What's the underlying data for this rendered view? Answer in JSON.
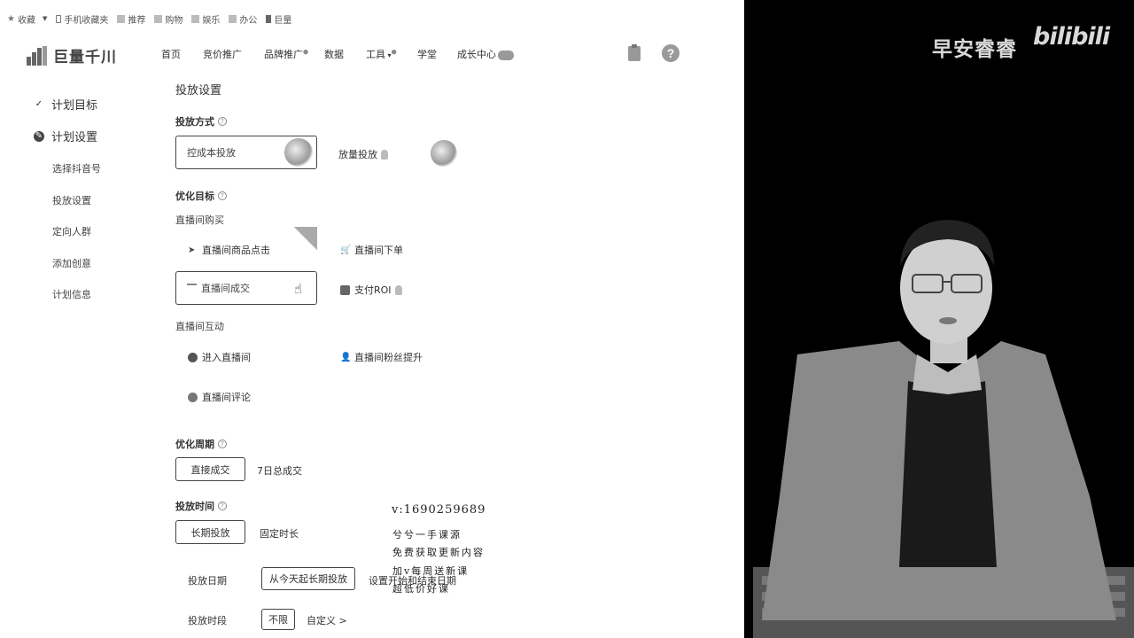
{
  "bookmarks": [
    "收藏",
    "手机收藏夹",
    "推荐",
    "购物",
    "娱乐",
    "办公",
    "巨量"
  ],
  "brand": {
    "name": "巨量千川"
  },
  "nav": {
    "items": [
      "首页",
      "竞价推广",
      "品牌推广",
      "数据",
      "工具",
      "学堂",
      "成长中心"
    ],
    "sup_dot": "●"
  },
  "sidebar": {
    "goal": "计划目标",
    "settings": "计划设置",
    "subs": [
      "选择抖音号",
      "投放设置",
      "定向人群",
      "添加创意",
      "计划信息"
    ]
  },
  "content": {
    "title": "投放设置",
    "mode": {
      "label": "投放方式",
      "options": [
        "控成本投放",
        "放量投放"
      ]
    },
    "opt_goal": {
      "label": "优化目标",
      "group1": "直播间购买",
      "g1_options": [
        "直播间商品点击",
        "直播间下单",
        "直播间成交",
        "支付ROI"
      ],
      "group2": "直播间互动",
      "g2_options": [
        "进入直播间",
        "直播间粉丝提升",
        "直播间评论"
      ]
    },
    "period": {
      "label": "优化周期",
      "options": [
        "直接成交",
        "7日总成交"
      ]
    },
    "time": {
      "label": "投放时间",
      "options": [
        "长期投放",
        "固定时长"
      ],
      "date_label": "投放日期",
      "date_value": "从今天起长期投放",
      "date_link": "设置开始和结束日期",
      "slot_label": "投放时段",
      "slot_value": "不限",
      "slot_link": "自定义 >"
    }
  },
  "watermark": {
    "contact": "v:1690259689",
    "lines": [
      "兮兮一手课源",
      "免费获取更新内容",
      "加v每周送新课",
      "超低价好课"
    ]
  },
  "video": {
    "channel": "早安睿睿",
    "platform": "bilibili"
  },
  "colors": {
    "app_bg": "#ffffff",
    "video_bg": "#000000",
    "border": "#444444"
  }
}
